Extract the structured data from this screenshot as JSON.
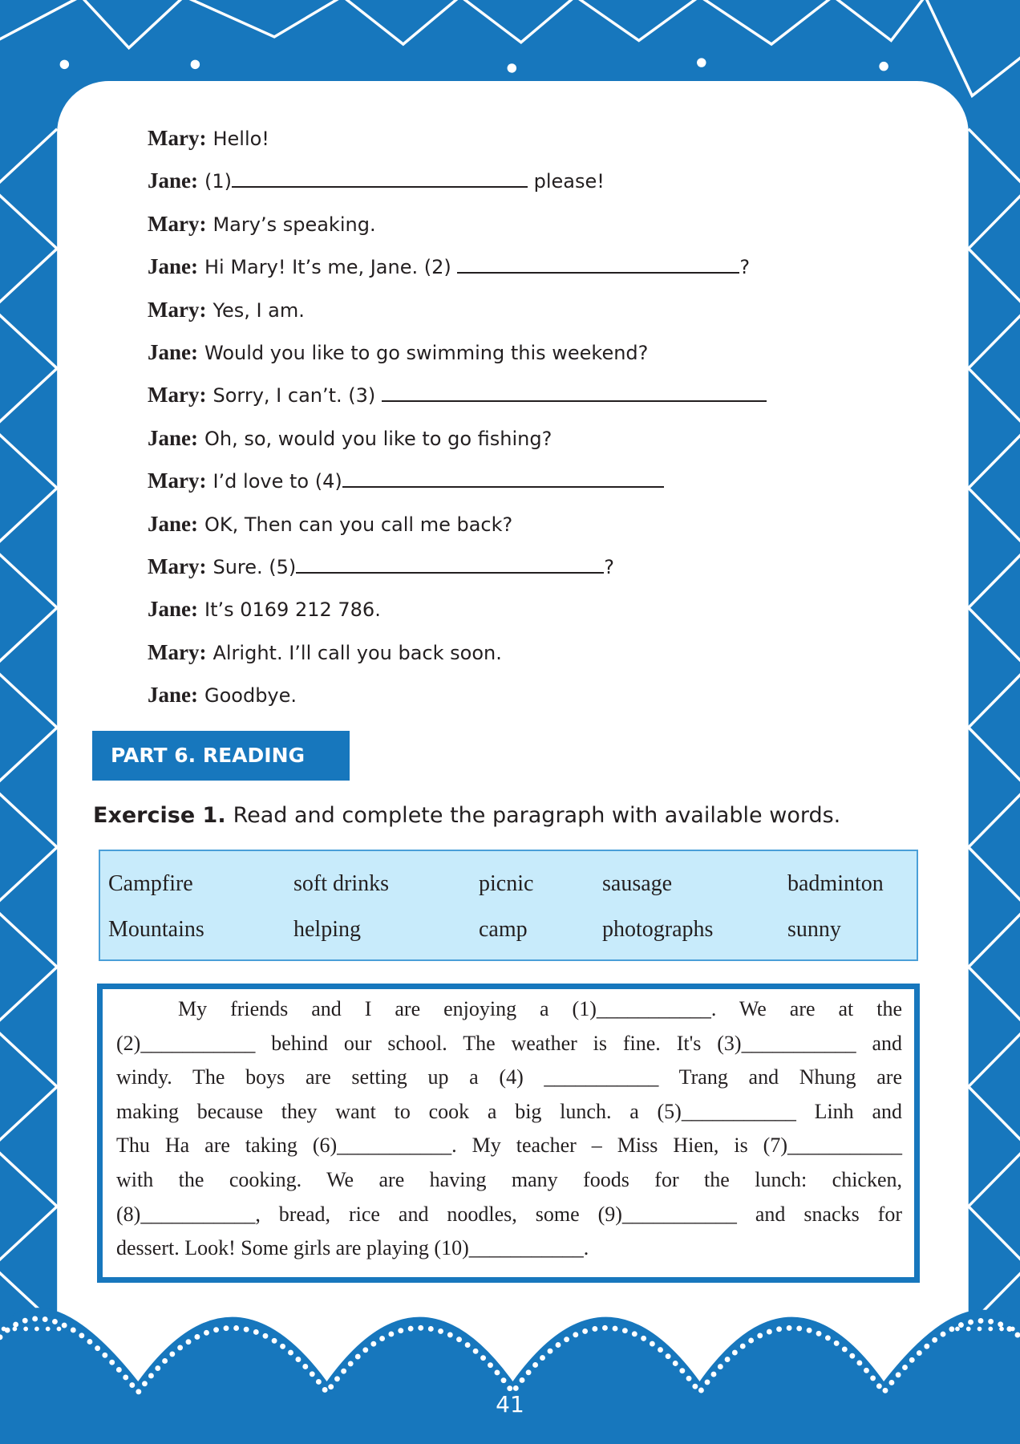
{
  "colors": {
    "brand_blue": "#1777bd",
    "word_box_bg": "#c8ebfb",
    "word_box_border": "#4a9fd8",
    "text": "#231f20"
  },
  "dialogue": [
    {
      "speaker": "Mary:",
      "text": "Hello!"
    },
    {
      "speaker": "Jane:",
      "text": "(1)",
      "after": " please!"
    },
    {
      "speaker": "Mary:",
      "text": "Mary’s speaking."
    },
    {
      "speaker": "Jane:",
      "text": "Hi Mary! It’s me, Jane. (2) ",
      "after": "?"
    },
    {
      "speaker": "Mary:",
      "text": "Yes, I am."
    },
    {
      "speaker": "Jane:",
      "text": "Would you like to go swimming this weekend?"
    },
    {
      "speaker": "Mary:",
      "text": "Sorry, I can’t. (3) "
    },
    {
      "speaker": "Jane:",
      "text": "Oh, so, would you like to go fishing?"
    },
    {
      "speaker": "Mary:",
      "text": "I’d love to (4)"
    },
    {
      "speaker": "Jane:",
      "text": "OK, Then can you call me back?"
    },
    {
      "speaker": "Mary:",
      "text": "Sure. (5)",
      "after": "?"
    },
    {
      "speaker": "Jane:",
      "text": "It’s 0169 212 786."
    },
    {
      "speaker": "Mary:",
      "text": "Alright. I’ll call you back soon."
    },
    {
      "speaker": "Jane:",
      "text": "Goodbye."
    }
  ],
  "section": {
    "label": "PART 6. READING"
  },
  "exercise": {
    "number": "Exercise 1.",
    "instruction": "Read and complete the paragraph with available words."
  },
  "word_box": {
    "rows": [
      [
        "Campfire",
        "soft drinks",
        "picnic",
        "sausage",
        "badminton"
      ],
      [
        "Mountains",
        "helping",
        "camp",
        "photographs",
        "sunny"
      ]
    ]
  },
  "paragraph": {
    "lines": [
      "My friends and I are enjoying a (1)___________. We are at the",
      "(2)___________ behind our school. The weather is fine. It's (3)___________ and",
      "windy. The boys are setting up a (4) ___________ Trang and Nhung are",
      "making because they want to cook a big lunch. a (5)___________ Linh and",
      "Thu Ha are taking (6)___________. My teacher – Miss Hien, is (7)___________",
      "with the cooking. We are having many foods for the lunch: chicken,",
      "(8)___________, bread, rice and noodles, some (9)___________ and snacks for",
      "dessert. Look! Some girls are playing (10)___________."
    ]
  },
  "page_number": "41"
}
